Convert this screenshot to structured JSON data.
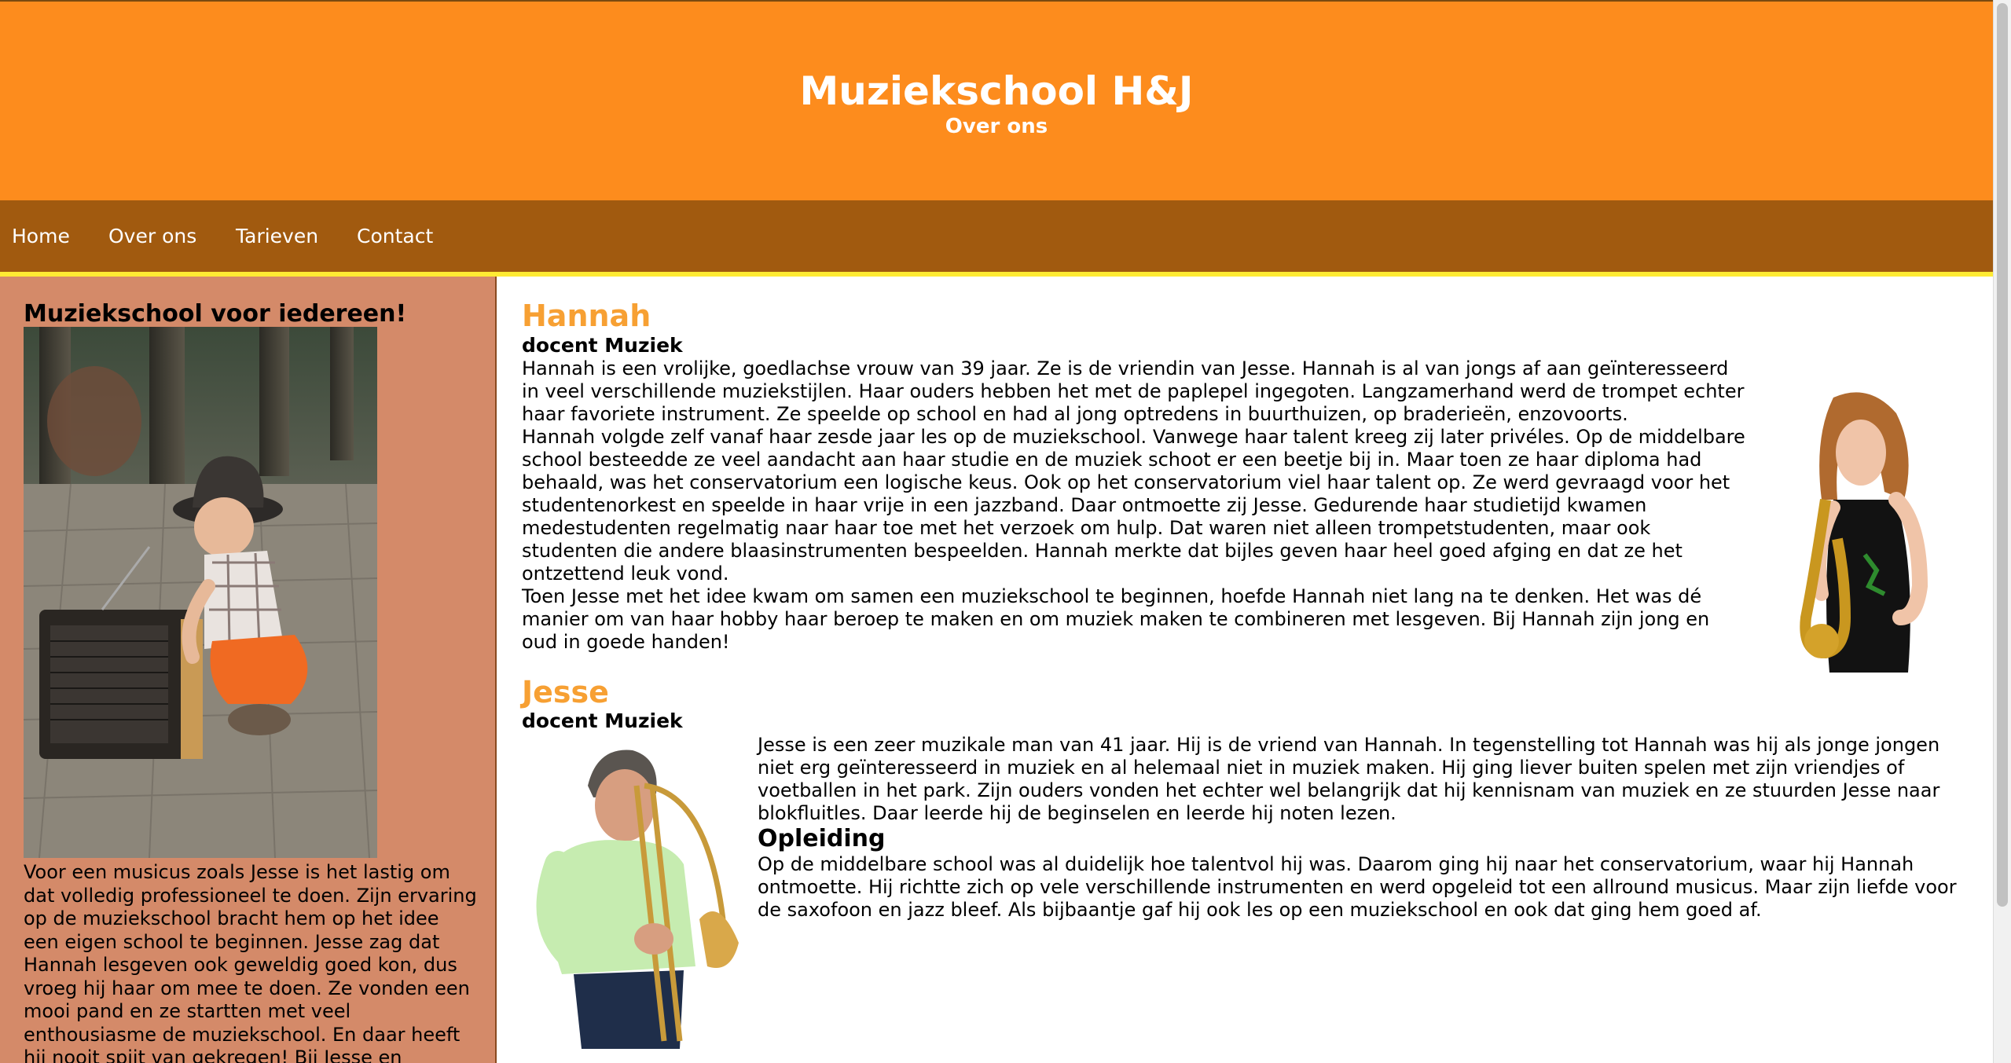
{
  "header": {
    "title": "Muziekschool H&J",
    "subtitle": "Over ons"
  },
  "nav": {
    "items": [
      {
        "label": "Home"
      },
      {
        "label": "Over ons"
      },
      {
        "label": "Tarieven"
      },
      {
        "label": "Contact"
      }
    ]
  },
  "sidebar": {
    "heading": "Muziekschool voor iedereen!",
    "text": "Voor een musicus zoals Jesse is het lastig om dat volledig professioneel te doen. Zijn ervaring op de muziekschool bracht hem op het idee een eigen school te beginnen. Jesse zag dat Hannah lesgeven ook geweldig goed kon, dus vroeg hij haar om mee te doen. Ze vonden een mooi pand en ze startten met veel enthousiasme de muziekschool. En daar heeft hij nooit spijt van gekregen! Bij Jesse en"
  },
  "hannah": {
    "name": "Hannah",
    "role": "docent Muziek",
    "paragraphs": [
      "Hannah is een vrolijke, goedlachse vrouw van 39 jaar. Ze is de vriendin van Jesse. Hannah is al van jongs af aan geïnteresseerd in veel verschillende muziekstijlen. Haar ouders hebben het met de paplepel ingegoten. Langzamerhand werd de trompet echter haar favoriete instrument. Ze speelde op school en had al jong optredens in buurthuizen, op braderieën, enzovoorts.",
      "Hannah volgde zelf vanaf haar zesde jaar les op de muziekschool. Vanwege haar talent kreeg zij later privéles. Op de middelbare school besteedde ze veel aandacht aan haar studie en de muziek schoot er een beetje bij in. Maar toen ze haar diploma had behaald, was het conservatorium een logische keus. Ook op het conservatorium viel haar talent op. Ze werd gevraagd voor het studentenorkest en speelde in haar vrije in een jazzband. Daar ontmoette zij Jesse. Gedurende haar studietijd kwamen medestudenten regelmatig naar haar toe met het verzoek om hulp. Dat waren niet alleen trompetstudenten, maar ook studenten die andere blaasinstrumenten bespeelden. Hannah merkte dat bijles geven haar heel goed afging en dat ze het ontzettend leuk vond.",
      "Toen Jesse met het idee kwam om samen een muziekschool te beginnen, hoefde Hannah niet lang na te denken. Het was dé manier om van haar hobby haar beroep te maken en om muziek maken te combineren met lesgeven. Bij Hannah zijn jong en oud in goede handen!"
    ]
  },
  "jesse": {
    "name": "Jesse",
    "role": "docent Muziek",
    "intro": "Jesse is een zeer muzikale man van 41 jaar. Hij is de vriend van Hannah. In tegenstelling tot Hannah was hij als jonge jongen niet erg geïnteresseerd in muziek en al helemaal niet in muziek maken. Hij ging liever buiten spelen met zijn vriendjes of voetballen in het park. Zijn ouders vonden het echter wel belangrijk dat hij kennisnam van muziek en ze stuurden Jesse naar blokfluitles. Daar leerde hij de beginselen en leerde hij noten lezen.",
    "opleiding_heading": "Opleiding",
    "opleiding_text": "Op de middelbare school was al duidelijk hoe talentvol hij was. Daarom ging hij naar het conservatorium, waar hij Hannah ontmoette. Hij richtte zich op vele verschillende instrumenten en werd opgeleid tot een allround musicus. Maar zijn liefde voor de saxofoon en jazz bleef. Als bijbaantje gaf hij ook les op een muziekschool en ook dat ging hem goed af."
  },
  "colors": {
    "header": "#fd8c1d",
    "nav": "#a15a0f",
    "nav_border": "#ffeb33",
    "sidebar": "#d48a69",
    "name_accent": "#f7a033"
  }
}
